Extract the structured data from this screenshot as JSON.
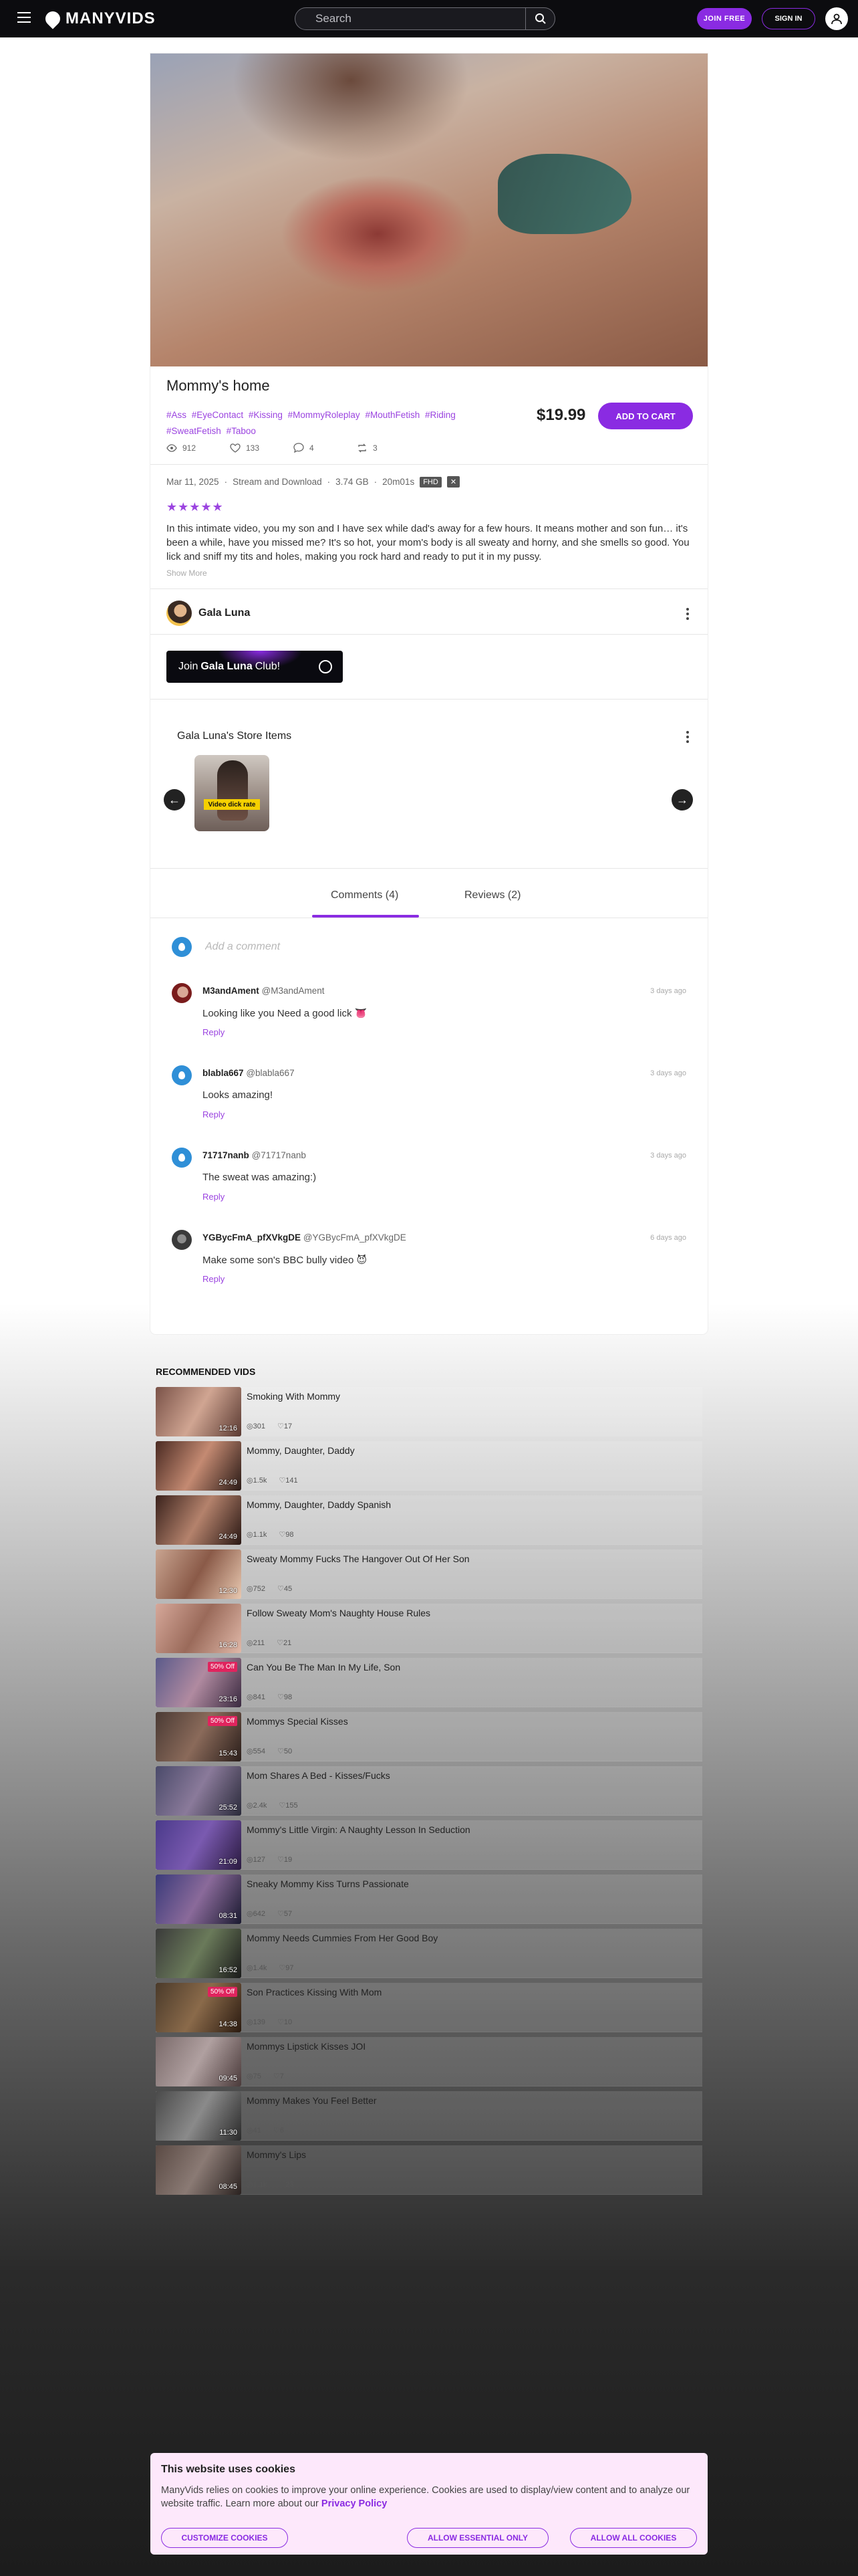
{
  "header": {
    "brand": "MANYVIDS",
    "search_placeholder": "Search",
    "join_label": "JOIN FREE",
    "signin_label": "SIGN IN"
  },
  "video": {
    "title": "Mommy's home",
    "tags": [
      "#Ass",
      "#EyeContact",
      "#Kissing",
      "#MommyRoleplay",
      "#MouthFetish",
      "#Riding",
      "#SweatFetish",
      "#Taboo"
    ],
    "views": "912",
    "likes": "133",
    "comments": "4",
    "shares": "3",
    "price": "$19.99",
    "add_to_cart": "ADD TO CART",
    "date": "Mar 11, 2025",
    "type": "Stream and Download",
    "size": "3.74 GB",
    "duration": "20m01s",
    "quality_badge": "FHD",
    "rating": 5,
    "stars": "★★★★★",
    "description": "In this intimate video, you my son and I have sex while dad's away for a few hours. It means mother and son fun… it's been a while, have you missed me? It's so hot, your mom's body is all sweaty and horny, and she smells so good. You lick and sniff my tits and holes, making you rock hard and ready to put it in my pussy.",
    "show_more": "Show More"
  },
  "creator": {
    "name": "Gala Luna",
    "club_prefix": "Join",
    "club_name": "Gala Luna",
    "club_suffix": "Club!",
    "store_title": "Gala Luna's Store Items",
    "store_item_label": "Video dick rate"
  },
  "tabs": {
    "comments": "Comments (4)",
    "reviews": "Reviews (2)"
  },
  "comments_section": {
    "add_placeholder": "Add a comment",
    "reply_label": "Reply",
    "items": [
      {
        "name": "M3andAment",
        "handle": "@M3andAment",
        "time": "3 days ago",
        "text": "Looking like you Need a good lick 👅"
      },
      {
        "name": "blabla667",
        "handle": "@blabla667",
        "time": "3 days ago",
        "text": "Looks amazing!"
      },
      {
        "name": "71717nanb",
        "handle": "@71717nanb",
        "time": "3 days ago",
        "text": "The sweat was amazing:)"
      },
      {
        "name": "YGBycFmA_pfXVkgDE",
        "handle": "@YGBycFmA_pfXVkgDE",
        "time": "6 days ago",
        "text": "Make some son's BBC bully video 😈"
      }
    ]
  },
  "recommended": {
    "title": "RECOMMENDED VIDS",
    "items": [
      {
        "name": "Smoking With Mommy",
        "duration": "12:16",
        "views": "301",
        "likes": "17",
        "off": ""
      },
      {
        "name": "Mommy, Daughter, Daddy",
        "duration": "24:49",
        "views": "1.5k",
        "likes": "141",
        "off": ""
      },
      {
        "name": "Mommy, Daughter, Daddy Spanish",
        "duration": "24:49",
        "views": "1.1k",
        "likes": "98",
        "off": ""
      },
      {
        "name": "Sweaty Mommy Fucks The Hangover Out Of Her Son",
        "duration": "12:30",
        "views": "752",
        "likes": "45",
        "off": ""
      },
      {
        "name": "Follow Sweaty Mom's Naughty House Rules",
        "duration": "16:28",
        "views": "211",
        "likes": "21",
        "off": ""
      },
      {
        "name": "Can You Be The Man In My Life, Son",
        "duration": "23:16",
        "views": "841",
        "likes": "98",
        "off": "50% Off"
      },
      {
        "name": "Mommys Special Kisses",
        "duration": "15:43",
        "views": "554",
        "likes": "50",
        "off": "50% Off"
      },
      {
        "name": "Mom Shares A Bed - Kisses/Fucks",
        "duration": "25:52",
        "views": "2.4k",
        "likes": "155",
        "off": ""
      },
      {
        "name": "Mommy's Little Virgin: A Naughty Lesson In Seduction",
        "duration": "21:09",
        "views": "127",
        "likes": "19",
        "off": ""
      },
      {
        "name": "Sneaky Mommy Kiss Turns Passionate",
        "duration": "08:31",
        "views": "642",
        "likes": "57",
        "off": ""
      },
      {
        "name": "Mommy Needs Cummies From Her Good Boy",
        "duration": "16:52",
        "views": "1.4k",
        "likes": "97",
        "off": ""
      },
      {
        "name": "Son Practices Kissing With Mom",
        "duration": "14:38",
        "views": "139",
        "likes": "10",
        "off": "50% Off"
      },
      {
        "name": "Mommys Lipstick Kisses JOI",
        "duration": "09:45",
        "views": "75",
        "likes": "7",
        "off": ""
      },
      {
        "name": "Mommy Makes You Feel Better",
        "duration": "11:30",
        "views": "41",
        "likes": "6",
        "off": ""
      },
      {
        "name": "Mommy's Lips",
        "duration": "08:45",
        "views": "1.1k",
        "likes": "23",
        "off": ""
      }
    ]
  },
  "cookie": {
    "title": "This website uses cookies",
    "text": "ManyVids relies on cookies to improve your online experience. Cookies are used to display/view content and to analyze our website traffic. Learn more about our",
    "link": "Privacy Policy",
    "customize": "CUSTOMIZE COOKIES",
    "essential": "ALLOW ESSENTIAL ONLY",
    "all": "ALLOW ALL COOKIES"
  },
  "colors": {
    "accent": "#8a2be2",
    "tag": "#9b44e0",
    "header_bg": "#0c0c0f",
    "cookie_bg": "#fde8fb"
  }
}
